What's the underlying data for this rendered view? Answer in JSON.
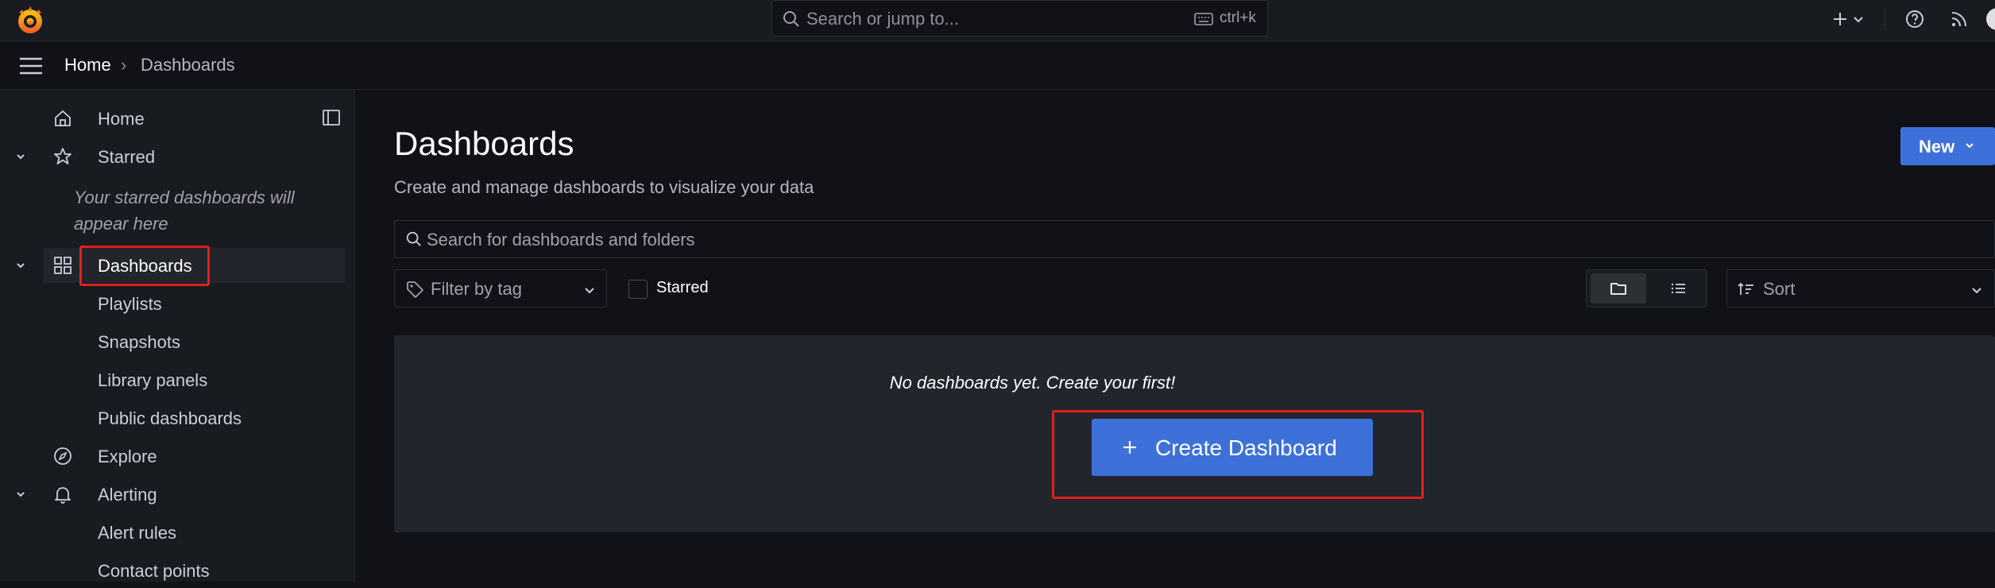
{
  "topbar": {
    "search_placeholder": "Search or jump to...",
    "shortcut": "ctrl+k",
    "icons": [
      "grafana-logo-icon",
      "search-icon",
      "keyboard-icon",
      "plus-icon",
      "chevron-down-icon",
      "help-icon",
      "rss-icon",
      "avatar"
    ]
  },
  "breadcrumb": {
    "home": "Home",
    "separator": "›",
    "current": "Dashboards"
  },
  "sidebar": {
    "items": [
      {
        "label": "Home",
        "icon": "home-icon"
      },
      {
        "label": "Starred",
        "icon": "star-icon"
      },
      {
        "label": "Dashboards",
        "icon": "apps-icon"
      },
      {
        "label": "Playlists"
      },
      {
        "label": "Snapshots"
      },
      {
        "label": "Library panels"
      },
      {
        "label": "Public dashboards"
      },
      {
        "label": "Explore",
        "icon": "compass-icon"
      },
      {
        "label": "Alerting",
        "icon": "bell-icon"
      },
      {
        "label": "Alert rules"
      },
      {
        "label": "Contact points"
      }
    ],
    "starred_empty": "Your starred dashboards will appear here"
  },
  "main": {
    "title": "Dashboards",
    "subtitle": "Create and manage dashboards to visualize your data",
    "new_button": "New",
    "search_placeholder": "Search for dashboards and folders",
    "tag_filter_placeholder": "Filter by tag",
    "starred_label": "Starred",
    "sort_label": "Sort",
    "empty_message": "No dashboards yet. Create your first!",
    "create_button": "Create Dashboard"
  },
  "colors": {
    "accent": "#3d71d9",
    "active_bar": "#f55f3e",
    "highlight": "#e0201b"
  }
}
